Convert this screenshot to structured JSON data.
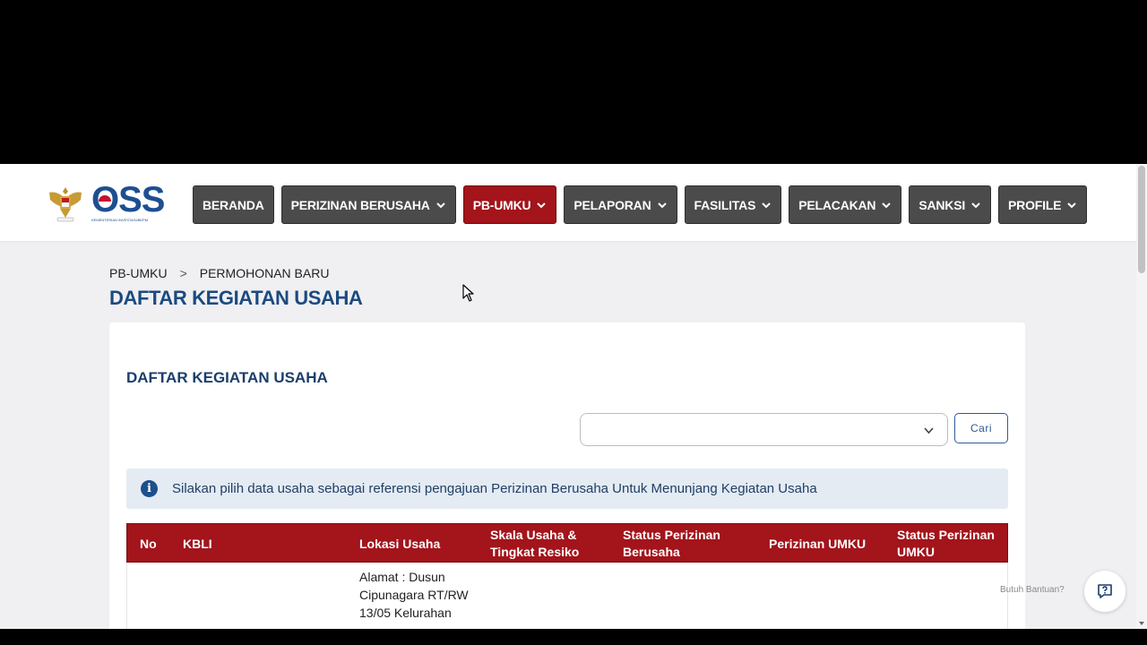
{
  "logo": {
    "name": "OSS",
    "subtitle": "KEMENTERIAN INVESTASI/BKPM"
  },
  "nav": {
    "items": [
      {
        "label": "BERANDA",
        "dropdown": false,
        "active": false
      },
      {
        "label": "PERIZINAN BERUSAHA",
        "dropdown": true,
        "active": false
      },
      {
        "label": "PB-UMKU",
        "dropdown": true,
        "active": true
      },
      {
        "label": "PELAPORAN",
        "dropdown": true,
        "active": false
      },
      {
        "label": "FASILITAS",
        "dropdown": true,
        "active": false
      },
      {
        "label": "PELACAKAN",
        "dropdown": true,
        "active": false
      },
      {
        "label": "SANKSI",
        "dropdown": true,
        "active": false
      },
      {
        "label": "PROFILE",
        "dropdown": true,
        "active": false
      }
    ]
  },
  "breadcrumb": {
    "items": [
      "PB-UMKU",
      "PERMOHONAN BARU"
    ],
    "separator": ">"
  },
  "page": {
    "title": "DAFTAR KEGIATAN USAHA"
  },
  "card": {
    "title": "DAFTAR KEGIATAN USAHA",
    "select": {
      "value": ""
    },
    "search_button": "Cari",
    "alert": "Silakan pilih data usaha sebagai referensi pengajuan Perizinan Berusaha Untuk Menunjang Kegiatan Usaha"
  },
  "table": {
    "columns": [
      "No",
      "KBLI",
      "Lokasi Usaha",
      "Skala Usaha & Tingkat Resiko",
      "Status Perizinan Berusaha",
      "Perizinan UMKU",
      "Status Perizinan UMKU"
    ],
    "rows": [
      {
        "no": "",
        "kbli": "",
        "lokasi": "Alamat : Dusun Cipunagara RT/RW 13/05 Kelurahan"
      }
    ]
  },
  "help": {
    "label": "Butuh Bantuan?"
  },
  "colors": {
    "primary": "#a3141b",
    "nav": "#4b4b4b",
    "title": "#1b4a80"
  }
}
